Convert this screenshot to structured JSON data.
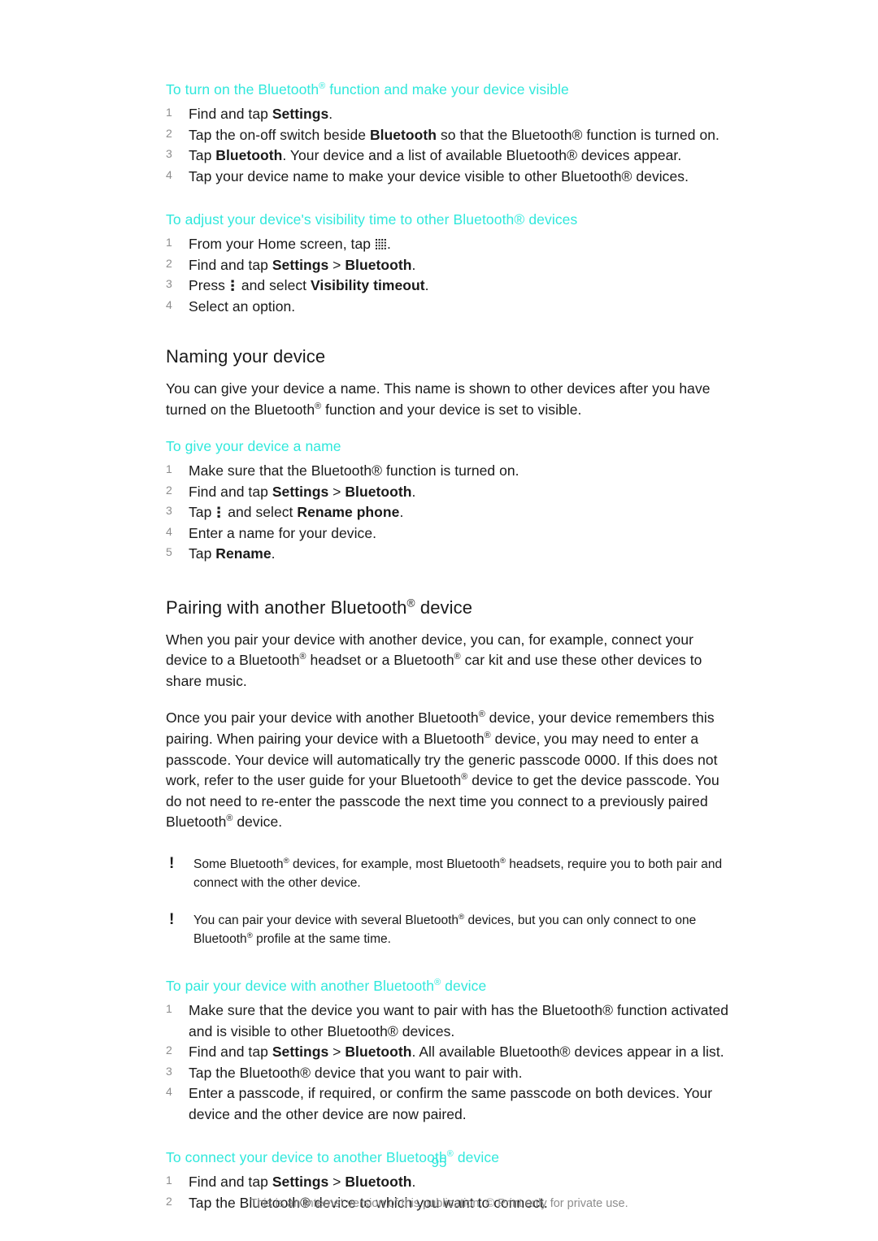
{
  "accent_color": "#30e8dc",
  "text_color": "#1a1a1a",
  "muted_color": "#8d8d8d",
  "sections": {
    "turn_on": {
      "title_pre": "To turn on the Bluetooth",
      "title_post": " function and make your device visible",
      "steps": [
        {
          "num": "1",
          "pre": "Find and tap ",
          "bold": "Settings",
          "post": "."
        },
        {
          "num": "2",
          "pre": "Tap the on-off switch beside ",
          "bold": "Bluetooth",
          "post": " so that the Bluetooth® function is turned on."
        },
        {
          "num": "3",
          "pre": "Tap ",
          "bold": "Bluetooth",
          "post": ". Your device and a list of available Bluetooth® devices appear."
        },
        {
          "num": "4",
          "pre": "",
          "bold": "",
          "post": "Tap your device name to make your device visible to other Bluetooth® devices."
        }
      ]
    },
    "visibility_time": {
      "title": "To adjust your device's visibility time to other Bluetooth® devices",
      "step1_pre": "From your Home screen, tap ",
      "step1_post": ".",
      "step2_pre": "Find and tap ",
      "step2_bold1": "Settings",
      "step2_mid": " > ",
      "step2_bold2": "Bluetooth",
      "step2_post": ".",
      "step3_pre": "Press ",
      "step3_mid": " and select ",
      "step3_bold": "Visibility timeout",
      "step3_post": ".",
      "step4": "Select an option.",
      "nums": [
        "1",
        "2",
        "3",
        "4"
      ]
    },
    "naming": {
      "heading": "Naming your device",
      "paragraph_pre": "You can give your device a name. This name is shown to other devices after you have turned on the Bluetooth",
      "paragraph_post": " function and your device is set to visible.",
      "proc_title": "To give your device a name",
      "steps": [
        {
          "num": "1",
          "pre": "Make sure that the Bluetooth® function is turned on.",
          "bold": "",
          "post": ""
        },
        {
          "num": "2",
          "pre": "Find and tap ",
          "bold": "Settings",
          "mid": " > ",
          "bold2": "Bluetooth",
          "post": "."
        },
        {
          "num": "3",
          "pre": "Tap ",
          "mid": " and select ",
          "bold": "Rename phone",
          "post": "."
        },
        {
          "num": "4",
          "pre": "Enter a name for your device.",
          "bold": "",
          "post": ""
        },
        {
          "num": "5",
          "pre": "Tap ",
          "bold": "Rename",
          "post": "."
        }
      ]
    },
    "pairing": {
      "heading_pre": "Pairing with another Bluetooth",
      "heading_post": " device",
      "para1_a": "When you pair your device with another device, you can, for example, connect your device to a Bluetooth",
      "para1_b": " headset or a Bluetooth",
      "para1_c": " car kit and use these other devices to share music.",
      "para2_a": "Once you pair your device with another Bluetooth",
      "para2_b": " device, your device remembers this pairing. When pairing your device with a Bluetooth",
      "para2_c": " device, you may need to enter a passcode. Your device will automatically try the generic passcode 0000. If this does not work, refer to the user guide for your Bluetooth",
      "para2_d": " device to get the device passcode. You do not need to re-enter the passcode the next time you connect to a previously paired Bluetooth",
      "para2_e": " device.",
      "note1_a": "Some Bluetooth",
      "note1_b": " devices, for example, most Bluetooth",
      "note1_c": " headsets, require you to both pair and connect with the other device.",
      "note2_a": "You can pair your device with several Bluetooth",
      "note2_b": " devices, but you can only connect to one Bluetooth",
      "note2_c": " profile at the same time.",
      "note_marker": "!"
    },
    "pair_proc": {
      "title_pre": "To pair your device with another Bluetooth",
      "title_post": " device",
      "steps": [
        {
          "num": "1",
          "text": "Make sure that the device you want to pair with has the Bluetooth® function activated and is visible to other Bluetooth® devices."
        },
        {
          "num": "2",
          "pre": "Find and tap ",
          "bold": "Settings",
          "mid": " > ",
          "bold2": "Bluetooth",
          "post": ". All available Bluetooth® devices appear in a list."
        },
        {
          "num": "3",
          "text": "Tap the Bluetooth® device that you want to pair with."
        },
        {
          "num": "4",
          "text": "Enter a passcode, if required, or confirm the same passcode on both devices. Your device and the other device are now paired."
        }
      ]
    },
    "connect_proc": {
      "title_pre": "To connect your device to another Bluetooth",
      "title_post": " device",
      "steps": [
        {
          "num": "1",
          "pre": "Find and tap ",
          "bold": "Settings",
          "mid": " > ",
          "bold2": "Bluetooth",
          "post": "."
        },
        {
          "num": "2",
          "text": "Tap the Bluetooth® device to which you want to connect."
        }
      ]
    }
  },
  "footer": {
    "page_number": "95",
    "disclaimer": "This is an Internet version of this publication. © Print only for private use."
  },
  "icons": {
    "app_drawer": "app-drawer-icon",
    "overflow": "overflow-menu-icon"
  }
}
